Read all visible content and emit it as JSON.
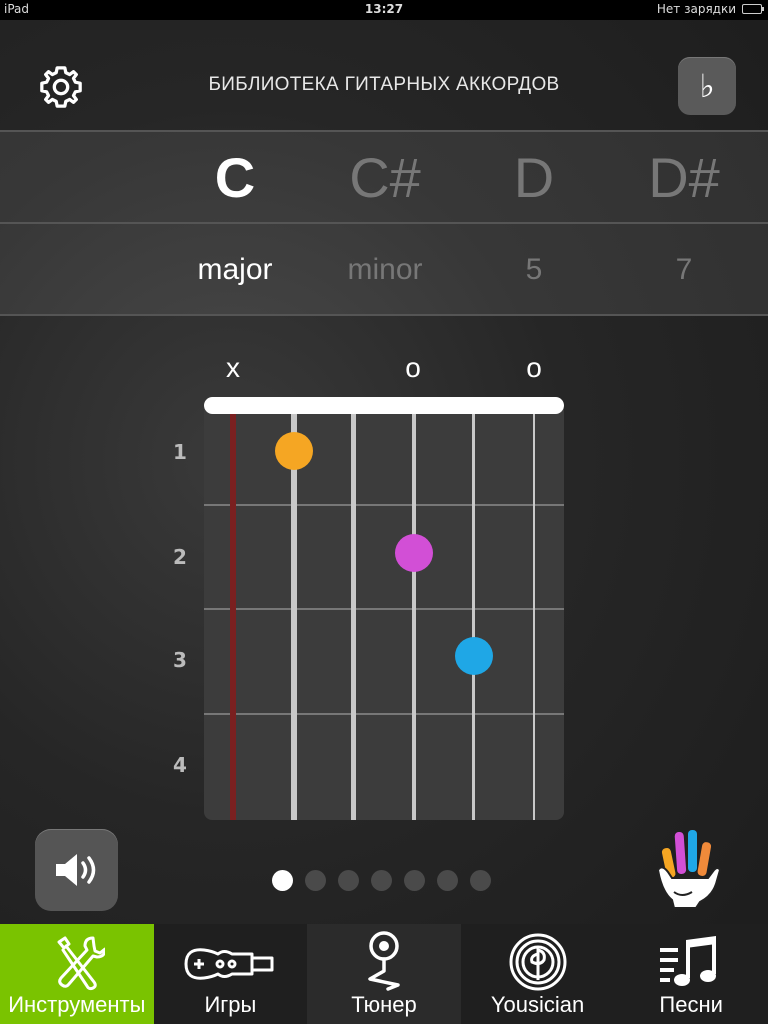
{
  "status": {
    "device": "iPad",
    "time": "13:27",
    "charging": "Нет зарядки"
  },
  "header": {
    "title": "БИБЛИОТЕКА ГИТАРНЫХ АККОРДОВ",
    "accidental_symbol": "♭"
  },
  "notes": [
    {
      "label": "C",
      "active": true
    },
    {
      "label": "C#",
      "active": false
    },
    {
      "label": "D",
      "active": false
    },
    {
      "label": "D#",
      "active": false
    }
  ],
  "chord_types": [
    {
      "label": "major",
      "active": true
    },
    {
      "label": "minor",
      "active": false
    },
    {
      "label": "5",
      "active": false
    },
    {
      "label": "7",
      "active": false
    }
  ],
  "chord_diagram": {
    "string_marks": [
      "x",
      "",
      "",
      "o",
      "",
      "o"
    ],
    "fret_numbers": [
      "1",
      "2",
      "3",
      "4"
    ],
    "fingers": [
      {
        "string": 5,
        "fret": 1,
        "color": "#f5a623"
      },
      {
        "string": 3,
        "fret": 2,
        "color": "#d24fd6"
      },
      {
        "string": 2,
        "fret": 3,
        "color": "#1fa7e6"
      }
    ],
    "muted_string_color": "#7a2020"
  },
  "pager": {
    "count": 7,
    "active_index": 0
  },
  "tabs": [
    {
      "label": "Инструменты",
      "icon": "tools-icon",
      "state": "active"
    },
    {
      "label": "Игры",
      "icon": "guitar-icon",
      "state": "normal"
    },
    {
      "label": "Тюнер",
      "icon": "tuner-icon",
      "state": "center"
    },
    {
      "label": "Yousician",
      "icon": "yousician-icon",
      "state": "normal"
    },
    {
      "label": "Песни",
      "icon": "songs-icon",
      "state": "normal"
    }
  ],
  "colors": {
    "accent_green": "#7ac300"
  }
}
